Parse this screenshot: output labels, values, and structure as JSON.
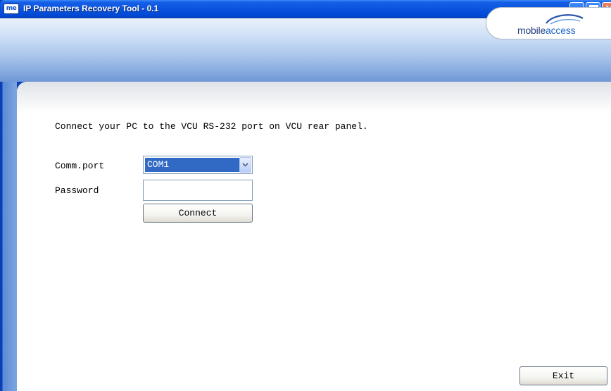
{
  "window": {
    "app_icon_text": "me",
    "title": "IP Parameters Recovery Tool - 0.1"
  },
  "header": {
    "logo_text_part1": "mobile",
    "logo_text_part2": "access"
  },
  "form": {
    "instruction": "Connect your PC to the VCU RS-232 port on VCU rear panel.",
    "comm_port_label": "Comm.port",
    "comm_port_value": "COM1",
    "password_label": "Password",
    "password_value": "",
    "connect_label": "Connect"
  },
  "footer": {
    "exit_label": "Exit"
  },
  "colors": {
    "title_bar": "#0a54de",
    "selection": "#316ac5",
    "close_button": "#d2421b"
  }
}
